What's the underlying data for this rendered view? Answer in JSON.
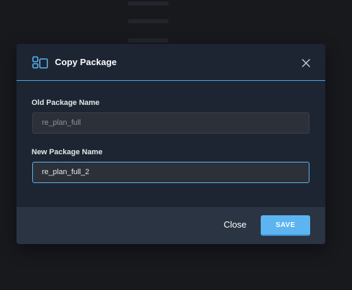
{
  "dialog": {
    "title": "Copy Package",
    "header_icon": "package-copy-icon",
    "close_icon": "close-icon"
  },
  "fields": {
    "old_name": {
      "label": "Old Package Name",
      "value": "re_plan_full"
    },
    "new_name": {
      "label": "New Package Name",
      "value": "re_plan_full_2"
    }
  },
  "footer": {
    "close_label": "Close",
    "save_label": "SAVE"
  },
  "colors": {
    "accent": "#5cb5f1",
    "modal_bg": "#1d2533",
    "footer_bg": "#2b3443",
    "page_bg": "#17191d"
  }
}
